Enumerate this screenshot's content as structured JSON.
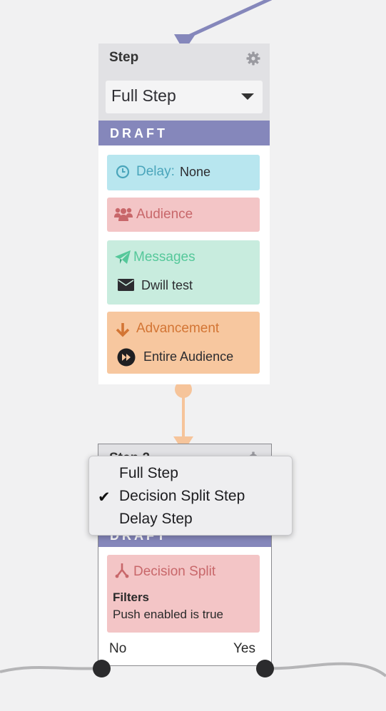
{
  "card1": {
    "title": "Step",
    "gear_icon": "gear-icon",
    "step_type": "Full Step",
    "status": "DRAFT",
    "delay": {
      "label": "Delay:",
      "value": "None",
      "icon": "clock-icon"
    },
    "audience": {
      "label": "Audience",
      "icon": "users-icon"
    },
    "messages": {
      "label": "Messages",
      "icon": "paper-plane-icon",
      "item": "Dwill test",
      "item_icon": "envelope-icon"
    },
    "advancement": {
      "label": "Advancement",
      "icon": "arrow-down-icon",
      "item": "Entire Audience",
      "item_icon": "fast-forward-icon"
    }
  },
  "card2": {
    "title_partial": "Step 2",
    "status": "DRAFT",
    "decision": {
      "label": "Decision Split",
      "icon": "split-icon",
      "filters_title": "Filters",
      "filters_value": "Push enabled is true"
    },
    "branch_no": "No",
    "branch_yes": "Yes"
  },
  "dropdown": {
    "options": [
      "Full Step",
      "Decision Split Step",
      "Delay Step"
    ],
    "selected_index": 1,
    "check_glyph": "✔"
  },
  "colors": {
    "draft": "#8587bb",
    "delay_bg": "#b8e6ef",
    "audience_bg": "#f3c5c6",
    "messages_bg": "#c8ecde",
    "advancement_bg": "#f7c79f",
    "connector": "#f6c49a"
  }
}
